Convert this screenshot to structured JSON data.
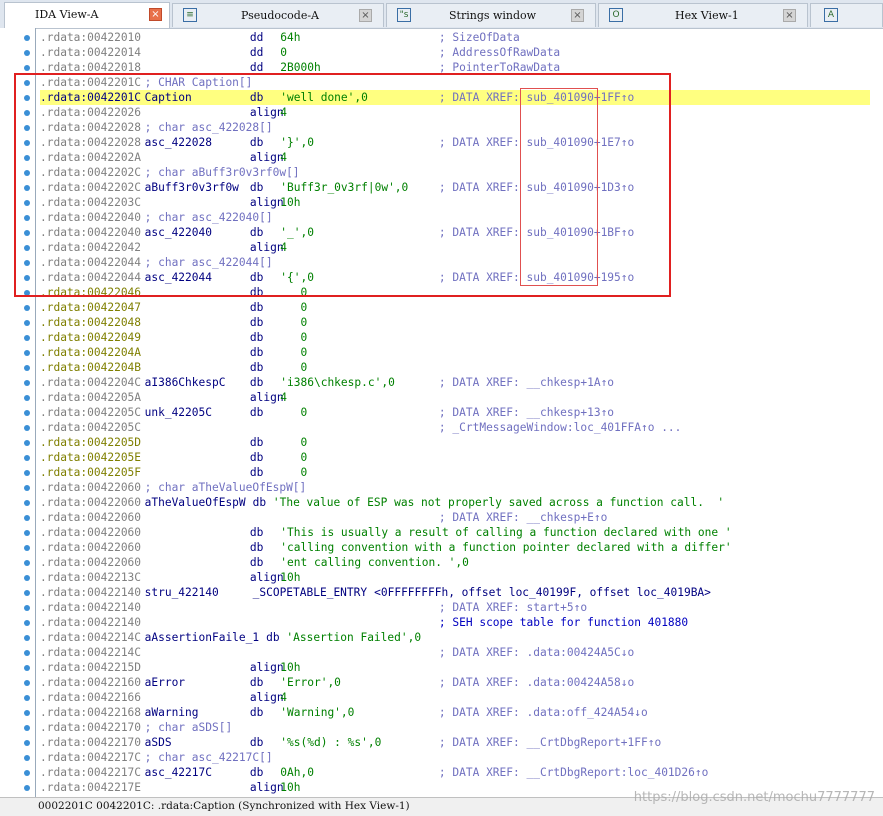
{
  "tabs": [
    {
      "label": "IDA View-A",
      "active": true,
      "icon": "none",
      "close": "close-icon"
    },
    {
      "label": "Pseudocode-A",
      "active": false,
      "icon": "pseudocode-icon",
      "close": "close-icon"
    },
    {
      "label": "Strings window",
      "active": false,
      "icon": "strings-icon",
      "close": "close-icon"
    },
    {
      "label": "Hex View-1",
      "active": false,
      "icon": "hex-icon",
      "close": "close-icon"
    },
    {
      "label": "",
      "active": false,
      "icon": "structures-icon",
      "close": ""
    }
  ],
  "tab_icon_glyphs": {
    "pseudocode-icon": "≡",
    "strings-icon": "\"s",
    "hex-icon": "O",
    "structures-icon": "A"
  },
  "colors": {
    "highlight_box": "#e02020",
    "xref_box": "#e05050",
    "gutter_dot": "#3a8fd6",
    "selection": "#ffff80"
  },
  "listing": [
    {
      "addr": ".rdata:00422010",
      "ac": "grey",
      "label": "",
      "mnem": "dd",
      "operand": "64h",
      "comment": "; SizeOfData"
    },
    {
      "addr": ".rdata:00422014",
      "ac": "grey",
      "label": "",
      "mnem": "dd",
      "operand": "0",
      "comment": "; AddressOfRawData"
    },
    {
      "addr": ".rdata:00422018",
      "ac": "grey",
      "label": "",
      "mnem": "dd",
      "operand": "2B000h",
      "comment": "; PointerToRawData"
    },
    {
      "addr": ".rdata:0042201C",
      "ac": "grey",
      "label": "",
      "mnem": "",
      "operand": "",
      "comment": "; CHAR Caption[]"
    },
    {
      "addr": ".rdata:0042201C",
      "ac": "blue",
      "label": "Caption",
      "mnem": "db",
      "operand": "'well done',0",
      "comment": "; DATA XREF: sub_401090+1FF↑o",
      "sel": true
    },
    {
      "addr": ".rdata:00422026",
      "ac": "grey",
      "label": "",
      "mnem": "align",
      "operand": "4",
      "comment": ""
    },
    {
      "addr": ".rdata:00422028",
      "ac": "grey",
      "label": "",
      "mnem": "",
      "operand": "",
      "comment": "; char asc_422028[]"
    },
    {
      "addr": ".rdata:00422028",
      "ac": "grey",
      "label": "asc_422028",
      "mnem": "db",
      "operand": "'}',0",
      "comment": "; DATA XREF: sub_401090+1E7↑o"
    },
    {
      "addr": ".rdata:0042202A",
      "ac": "grey",
      "label": "",
      "mnem": "align",
      "operand": "4",
      "comment": ""
    },
    {
      "addr": ".rdata:0042202C",
      "ac": "grey",
      "label": "",
      "mnem": "",
      "operand": "",
      "comment": "; char aBuff3r0v3rf0w[]"
    },
    {
      "addr": ".rdata:0042202C",
      "ac": "grey",
      "label": "aBuff3r0v3rf0w",
      "mnem": "db",
      "operand": "'Buff3r_0v3rf|0w',0",
      "comment": "; DATA XREF: sub_401090+1D3↑o"
    },
    {
      "addr": ".rdata:0042203C",
      "ac": "grey",
      "label": "",
      "mnem": "align",
      "operand": "10h",
      "comment": ""
    },
    {
      "addr": ".rdata:00422040",
      "ac": "grey",
      "label": "",
      "mnem": "",
      "operand": "",
      "comment": "; char asc_422040[]"
    },
    {
      "addr": ".rdata:00422040",
      "ac": "grey",
      "label": "asc_422040",
      "mnem": "db",
      "operand": "'_',0",
      "comment": "; DATA XREF: sub_401090+1BF↑o"
    },
    {
      "addr": ".rdata:00422042",
      "ac": "grey",
      "label": "",
      "mnem": "align",
      "operand": "4",
      "comment": ""
    },
    {
      "addr": ".rdata:00422044",
      "ac": "grey",
      "label": "",
      "mnem": "",
      "operand": "",
      "comment": "; char asc_422044[]"
    },
    {
      "addr": ".rdata:00422044",
      "ac": "grey",
      "label": "asc_422044",
      "mnem": "db",
      "operand": "'{',0",
      "comment": "; DATA XREF: sub_401090+195↑o"
    },
    {
      "addr": ".rdata:00422046",
      "ac": "green",
      "label": "",
      "mnem": "db",
      "operand": "   0",
      "comment": ""
    },
    {
      "addr": ".rdata:00422047",
      "ac": "green",
      "label": "",
      "mnem": "db",
      "operand": "   0",
      "comment": ""
    },
    {
      "addr": ".rdata:00422048",
      "ac": "green",
      "label": "",
      "mnem": "db",
      "operand": "   0",
      "comment": ""
    },
    {
      "addr": ".rdata:00422049",
      "ac": "green",
      "label": "",
      "mnem": "db",
      "operand": "   0",
      "comment": ""
    },
    {
      "addr": ".rdata:0042204A",
      "ac": "green",
      "label": "",
      "mnem": "db",
      "operand": "   0",
      "comment": ""
    },
    {
      "addr": ".rdata:0042204B",
      "ac": "green",
      "label": "",
      "mnem": "db",
      "operand": "   0",
      "comment": ""
    },
    {
      "addr": ".rdata:0042204C",
      "ac": "grey",
      "label": "aI386ChkespC",
      "mnem": "db",
      "operand": "'i386\\chkesp.c',0",
      "comment": "; DATA XREF: __chkesp+1A↑o"
    },
    {
      "addr": ".rdata:0042205A",
      "ac": "grey",
      "label": "",
      "mnem": "align",
      "operand": "4",
      "comment": ""
    },
    {
      "addr": ".rdata:0042205C",
      "ac": "grey",
      "label": "unk_42205C",
      "mnem": "db",
      "operand": "   0",
      "comment": "; DATA XREF: __chkesp+13↑o"
    },
    {
      "addr": ".rdata:0042205C",
      "ac": "grey",
      "label": "",
      "mnem": "",
      "operand": "",
      "comment": "; _CrtMessageWindow:loc_401FFA↑o ..."
    },
    {
      "addr": ".rdata:0042205D",
      "ac": "green",
      "label": "",
      "mnem": "db",
      "operand": "   0",
      "comment": ""
    },
    {
      "addr": ".rdata:0042205E",
      "ac": "green",
      "label": "",
      "mnem": "db",
      "operand": "   0",
      "comment": ""
    },
    {
      "addr": ".rdata:0042205F",
      "ac": "green",
      "label": "",
      "mnem": "db",
      "operand": "   0",
      "comment": ""
    },
    {
      "addr": ".rdata:00422060",
      "ac": "grey",
      "label": "",
      "mnem": "",
      "operand": "",
      "comment": "; char aTheValueOfEspW[]"
    },
    {
      "addr": ".rdata:00422060",
      "ac": "grey",
      "label": "aTheValueOfEspW",
      "mnem": "db",
      "operand": "'The value of ESP was not properly saved across a function call.  '",
      "comment": ""
    },
    {
      "addr": ".rdata:00422060",
      "ac": "grey",
      "label": "",
      "mnem": "",
      "operand": "",
      "comment": "; DATA XREF: __chkesp+E↑o"
    },
    {
      "addr": ".rdata:00422060",
      "ac": "grey",
      "label": "",
      "mnem": "db",
      "operand": "'This is usually a result of calling a function declared with one '",
      "comment": ""
    },
    {
      "addr": ".rdata:00422060",
      "ac": "grey",
      "label": "",
      "mnem": "db",
      "operand": "'calling convention with a function pointer declared with a differ'",
      "comment": ""
    },
    {
      "addr": ".rdata:00422060",
      "ac": "grey",
      "label": "",
      "mnem": "db",
      "operand": "'ent calling convention. ',0",
      "comment": ""
    },
    {
      "addr": ".rdata:0042213C",
      "ac": "grey",
      "label": "",
      "mnem": "align",
      "operand": "10h",
      "comment": ""
    },
    {
      "addr": ".rdata:00422140",
      "ac": "grey",
      "label": "stru_422140",
      "mnem": "_SCOPETABLE_ENTRY",
      "operand": "<0FFFFFFFFh, offset loc_40199F, offset loc_4019BA>",
      "comment": ""
    },
    {
      "addr": ".rdata:00422140",
      "ac": "grey",
      "label": "",
      "mnem": "",
      "operand": "",
      "comment": "; DATA XREF: start+5↑o"
    },
    {
      "addr": ".rdata:00422140",
      "ac": "grey",
      "label": "",
      "mnem": "",
      "operand": "",
      "comment": "; SEH scope table for function 401880",
      "cblue": true
    },
    {
      "addr": ".rdata:0042214C",
      "ac": "grey",
      "label": "aAssertionFaile_1",
      "mnem": "db",
      "operand": "'Assertion Failed',0",
      "comment": ""
    },
    {
      "addr": ".rdata:0042214C",
      "ac": "grey",
      "label": "",
      "mnem": "",
      "operand": "",
      "comment": "; DATA XREF: .data:00424A5C↓o"
    },
    {
      "addr": ".rdata:0042215D",
      "ac": "grey",
      "label": "",
      "mnem": "align",
      "operand": "10h",
      "comment": ""
    },
    {
      "addr": ".rdata:00422160",
      "ac": "grey",
      "label": "aError",
      "mnem": "db",
      "operand": "'Error',0",
      "comment": "; DATA XREF: .data:00424A58↓o"
    },
    {
      "addr": ".rdata:00422166",
      "ac": "grey",
      "label": "",
      "mnem": "align",
      "operand": "4",
      "comment": ""
    },
    {
      "addr": ".rdata:00422168",
      "ac": "grey",
      "label": "aWarning",
      "mnem": "db",
      "operand": "'Warning',0",
      "comment": "; DATA XREF: .data:off_424A54↓o"
    },
    {
      "addr": ".rdata:00422170",
      "ac": "grey",
      "label": "",
      "mnem": "",
      "operand": "",
      "comment": "; char aSDS[]"
    },
    {
      "addr": ".rdata:00422170",
      "ac": "grey",
      "label": "aSDS",
      "mnem": "db",
      "operand": "'%s(%d) : %s',0",
      "comment": "; DATA XREF: __CrtDbgReport+1FF↑o"
    },
    {
      "addr": ".rdata:0042217C",
      "ac": "grey",
      "label": "",
      "mnem": "",
      "operand": "",
      "comment": "; char asc_42217C[]"
    },
    {
      "addr": ".rdata:0042217C",
      "ac": "grey",
      "label": "asc_42217C",
      "mnem": "db",
      "operand": "0Ah,0",
      "comment": "; DATA XREF: __CrtDbgReport:loc_401D26↑o"
    },
    {
      "addr": ".rdata:0042217E",
      "ac": "grey",
      "label": "",
      "mnem": "align",
      "operand": "10h",
      "comment": ""
    }
  ],
  "status_text": "0002201C 0042201C: .rdata:Caption (Synchronized with Hex View-1)",
  "watermark": "https://blog.csdn.net/mochu7777777"
}
